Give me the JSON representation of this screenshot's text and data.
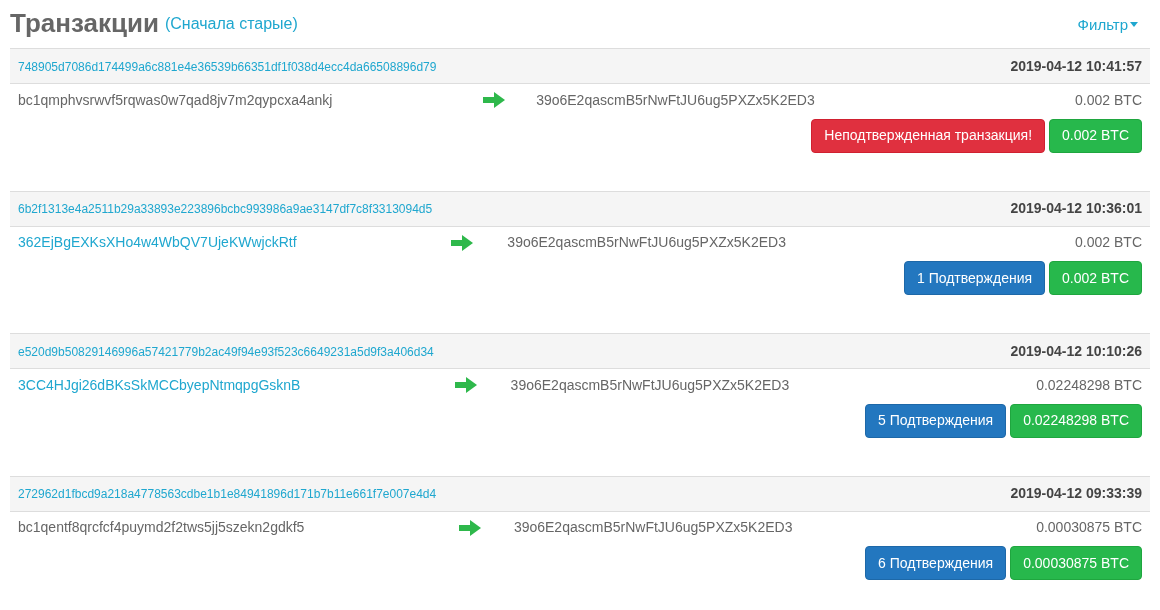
{
  "title": "Транзакции",
  "sort_link": "(Сначала старые)",
  "filter_button": "Фильтр",
  "transactions": [
    {
      "hash": "748905d7086d174499a6c881e4e36539b66351df1f038d4ecc4da66508896d79",
      "time": "2019-04-12 10:41:57",
      "from": "bc1qmphvsrwvf5rqwas0w7qad8jv7m2qypcxa4ankj",
      "from_link": false,
      "to": "39o6E2qascmB5rNwFtJU6ug5PXZx5K2ED3",
      "amount": "0.002 BTC",
      "status": {
        "kind": "unconfirmed",
        "text": "Неподтвержденная транзакция!"
      },
      "total": "0.002 BTC"
    },
    {
      "hash": "6b2f1313e4a2511b29a33893e223896bcbc993986a9ae3147df7c8f3313094d5",
      "time": "2019-04-12 10:36:01",
      "from": "362EjBgEXKsXHo4w4WbQV7UjeKWwjckRtf",
      "from_link": true,
      "to": "39o6E2qascmB5rNwFtJU6ug5PXZx5K2ED3",
      "amount": "0.002 BTC",
      "status": {
        "kind": "confirmed",
        "text": "1 Подтверждения"
      },
      "total": "0.002 BTC"
    },
    {
      "hash": "e520d9b50829146996a57421779b2ac49f94e93f523c6649231a5d9f3a406d34",
      "time": "2019-04-12 10:10:26",
      "from": "3CC4HJgi26dBKsSkMCCbyepNtmqpgGsknB",
      "from_link": true,
      "to": "39o6E2qascmB5rNwFtJU6ug5PXZx5K2ED3",
      "amount": "0.02248298 BTC",
      "status": {
        "kind": "confirmed",
        "text": "5 Подтверждения"
      },
      "total": "0.02248298 BTC"
    },
    {
      "hash": "272962d1fbcd9a218a4778563cdbe1b1e84941896d171b7b11e661f7e007e4d4",
      "time": "2019-04-12 09:33:39",
      "from": "bc1qentf8qrcfcf4puymd2f2tws5jj5szekn2gdkf5",
      "from_link": false,
      "to": "39o6E2qascmB5rNwFtJU6ug5PXZx5K2ED3",
      "amount": "0.00030875 BTC",
      "status": {
        "kind": "confirmed",
        "text": "6 Подтверждения"
      },
      "total": "0.00030875 BTC"
    }
  ]
}
